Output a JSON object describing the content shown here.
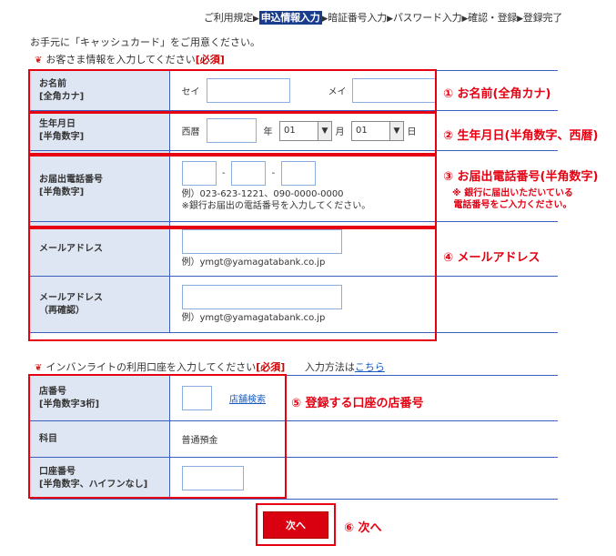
{
  "steps": {
    "s1": "ご利用規定",
    "s2": "申込情報入力",
    "s3": "暗証番号入力",
    "s4": "パスワード入力",
    "s5": "確認・登録",
    "s6": "登録完了",
    "arrow": "▶"
  },
  "intro": "お手元に「キャッシュカード」をご用意ください。",
  "section1": {
    "text": "お客さま情報を入力してください",
    "required": "[必須]"
  },
  "section2": {
    "text": "インバンライトの利用口座を入力してください",
    "required": "[必須]",
    "method_prefix": "入力方法は",
    "method_link": "こちら"
  },
  "form1": {
    "name": {
      "label1": "お名前",
      "label2": "[全角カナ]",
      "sei": "セイ",
      "mei": "メイ"
    },
    "birth": {
      "label1": "生年月日",
      "label2": "[半角数字]",
      "era": "西暦",
      "year": "年",
      "month_value": "01",
      "month": "月",
      "day_value": "01",
      "day": "日"
    },
    "phone": {
      "label1": "お届出電話番号",
      "label2": "[半角数字]",
      "dash": "-",
      "example": "例）023-623-1221、090-0000-0000",
      "note": "※銀行お届出の電話番号を入力してください。"
    },
    "email": {
      "label1": "メールアドレス",
      "example": "例）ymgt@yamagatabank.co.jp"
    },
    "email_confirm": {
      "label1": "メールアドレス",
      "label2": "（再確認）",
      "example": "例）ymgt@yamagatabank.co.jp"
    }
  },
  "form2": {
    "branch": {
      "label1": "店番号",
      "label2": "[半角数字3桁]",
      "link": "店舗検索"
    },
    "subject": {
      "label1": "科目",
      "value": "普通預金"
    },
    "account": {
      "label1": "口座番号",
      "label2": "[半角数字、ハイフンなし]"
    }
  },
  "callouts": {
    "c1": "① お名前(全角カナ)",
    "c2": "② 生年月日(半角数字、西暦)",
    "c3": "③ お届出電話番号(半角数字)",
    "c3_note1": "※ 銀行に届出いただいている",
    "c3_note2": "電話番号をご入力ください。",
    "c4": "④ メールアドレス",
    "c5": "⑤ 登録する口座の店番号",
    "c6": "⑥ 次へ"
  },
  "next_button": "次へ"
}
